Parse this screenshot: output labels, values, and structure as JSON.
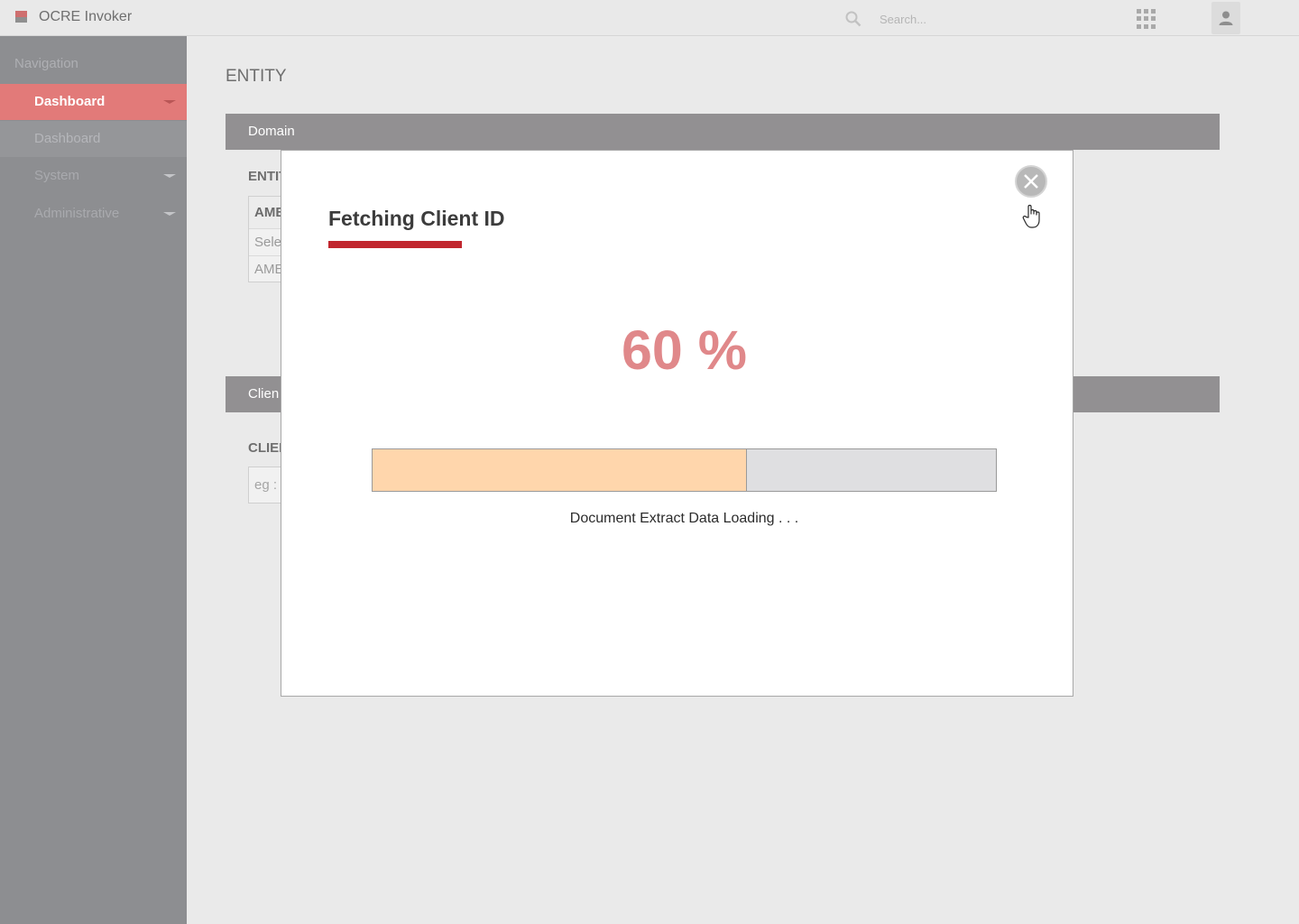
{
  "app": {
    "title": "OCRE Invoker"
  },
  "search": {
    "placeholder": "Search..."
  },
  "sidebar": {
    "heading": "Navigation",
    "items": [
      {
        "label": "Dashboard",
        "state": "active",
        "has_caret": true
      },
      {
        "label": "Dashboard",
        "state": "sub",
        "has_caret": false
      },
      {
        "label": "System",
        "state": "plain",
        "has_caret": true
      },
      {
        "label": "Administrative",
        "state": "plain",
        "has_caret": true
      }
    ]
  },
  "main": {
    "page_title": "ENTITY",
    "domain_panel": {
      "header": "Domain",
      "field_label": "ENTIT",
      "select_options": [
        "AME",
        "Sele",
        "AME"
      ]
    },
    "client_panel": {
      "header": "Clien",
      "field_label": "CLIEI",
      "input_placeholder": "eg :"
    }
  },
  "modal": {
    "title": "Fetching Client ID",
    "progress_text": "60 %",
    "progress_fraction": 0.6,
    "status": "Document Extract Data Loading  . . .",
    "icons": {
      "close": "close-circle-icon",
      "cursor": "hand-pointer-icon"
    }
  },
  "colors": {
    "accent_red": "#c1262e",
    "active_nav": "#e27a79",
    "progress_fill": "#ffd6ac",
    "progress_text": "#e0888a"
  }
}
